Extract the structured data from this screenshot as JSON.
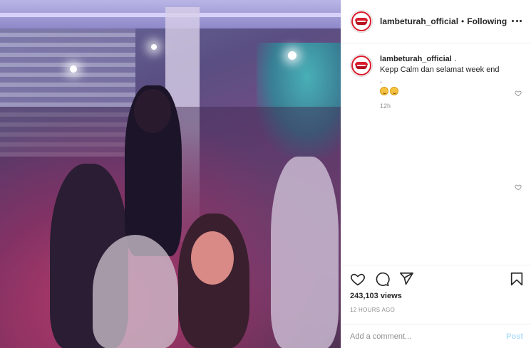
{
  "header": {
    "username": "lambeturah_official",
    "separator": "•",
    "follow_status": "Following"
  },
  "caption": {
    "username": "lambeturah_official",
    "suffix": ".",
    "line1": "Kepp Calm dan selamat week end",
    "line2": ".",
    "emojis": [
      "face-emoji",
      "face-emoji"
    ],
    "time": "12h"
  },
  "stats": {
    "views": "243,103 views",
    "posted": "12 HOURS AGO"
  },
  "comment_box": {
    "placeholder": "Add a comment...",
    "post_label": "Post"
  },
  "colors": {
    "brand_red": "#d91c2c",
    "post_button": "#b2dffc",
    "text": "#262626",
    "muted": "#8e8e8e"
  }
}
